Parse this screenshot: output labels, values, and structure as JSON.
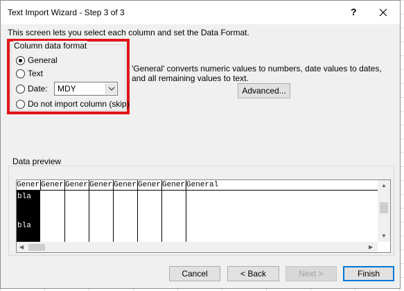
{
  "window": {
    "title": "Text Import Wizard - Step 3 of 3",
    "help_label": "?"
  },
  "intro_text": "This screen lets you select each column and set the Data Format.",
  "column_format": {
    "legend": "Column data format",
    "options": [
      {
        "label": "General",
        "checked": true
      },
      {
        "label": "Text",
        "checked": false
      },
      {
        "label": "Date:",
        "checked": false
      },
      {
        "label": "Do not import column (skip)",
        "checked": false
      }
    ],
    "date_value": "MDY"
  },
  "description": "'General' converts numeric values to numbers, date values to dates, and all remaining values to text.",
  "advanced_label": "Advanced...",
  "preview": {
    "label": "Data preview",
    "headers": [
      "General",
      "General",
      "General",
      "General",
      "General",
      "General",
      "General",
      "General"
    ],
    "rows": [
      [
        "bla"
      ],
      [
        "bla"
      ]
    ]
  },
  "footer": {
    "cancel_label": "Cancel",
    "back_label": "< Back",
    "next_label": "Next >",
    "finish_label": "Finish"
  },
  "colors": {
    "highlight_border": "#e2141a",
    "default_button_border": "#0078d7"
  },
  "icons": {
    "close": "close-icon",
    "dropdown": "chevron-down-icon"
  }
}
